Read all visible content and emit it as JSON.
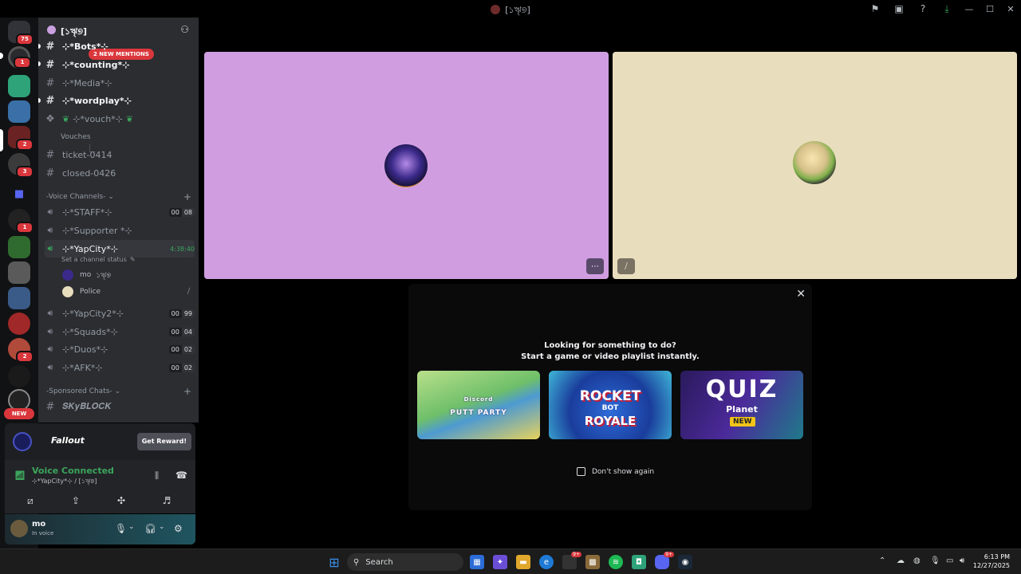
{
  "window": {
    "title": "[১ৠ୭]"
  },
  "titlebar_icons": [
    "flag-icon",
    "screen-icon",
    "help-icon",
    "download-icon"
  ],
  "window_controls": {
    "minimize": "—",
    "maximize": "☐",
    "close": "✕"
  },
  "rail": {
    "top_badge": "75",
    "badges": [
      "1",
      "2",
      "3",
      "1",
      "2"
    ],
    "new_label": "NEW"
  },
  "server": {
    "name": "[১ৠ୭]"
  },
  "mentions_label": "2 NEW MENTIONS",
  "channels": {
    "bots": "⊹*Bots*⊹",
    "counting": "⊹*counting*⊹",
    "media": "⊹*Media*⊹",
    "wordplay": "⊹*wordplay*⊹",
    "vouch": "⊹*vouch*⊹",
    "vouches": "Vouches",
    "ticket": "ticket-0414",
    "closed": "closed-0426"
  },
  "voice_category": "-Voice Channels-",
  "voice_channels": {
    "staff": {
      "name": "⊹*STAFF*⊹",
      "a": "00",
      "b": "08"
    },
    "supporter": {
      "name": "⊹*Supporter *⊹"
    },
    "yapcity": {
      "name": "⊹*YapCity*⊹",
      "time": "4:38:40",
      "status": "Set a channel status"
    },
    "yapcity2": {
      "name": "⊹*YapCity2*⊹",
      "a": "00",
      "b": "99"
    },
    "squads": {
      "name": "⊹*Squads*⊹",
      "a": "00",
      "b": "04"
    },
    "duos": {
      "name": "⊹*Duos*⊹",
      "a": "00",
      "b": "02"
    },
    "afk": {
      "name": "⊹*AFK*⊹",
      "a": "00",
      "b": "02"
    }
  },
  "voice_users": [
    {
      "name": "mo",
      "tag": "১ৠ୭"
    },
    {
      "name": "Police"
    }
  ],
  "sponsored_category": "-Sponsored Chats-",
  "sponsored_channel": "𝑺𝑲𝒚𝑩𝑳𝑶𝑪𝑲",
  "promo": {
    "brand": "Fallout",
    "button": "Get Reward!"
  },
  "voice_panel": {
    "status": "Voice Connected",
    "channel": "⊹*YapCity*⊹ / [১ৠ୭]"
  },
  "user": {
    "name": "mo",
    "status": "In voice"
  },
  "activity": {
    "line1": "Looking for something to do?",
    "line2": "Start a game or video playlist instantly.",
    "games": [
      {
        "brand": "Discord",
        "title": "PUTT PARTY"
      },
      {
        "title1": "ROCKET",
        "title2": "BOT",
        "title3": "ROYALE"
      },
      {
        "title1": "QUIZ",
        "title2": "Planet",
        "badge": "NEW"
      }
    ],
    "dont_show": "Don't show again"
  },
  "tile_buttons": {
    "more": "⋯",
    "muted": "⧸"
  },
  "taskbar": {
    "search_placeholder": "Search",
    "badge1": "9+",
    "badge2": "9+",
    "time": "6:13 PM",
    "date": "12/27/2025"
  },
  "colors": {
    "tile1": "#d09ee0",
    "tile2": "#e8ddbd",
    "voice_green": "#3ba55c",
    "mention_red": "#da373c"
  }
}
